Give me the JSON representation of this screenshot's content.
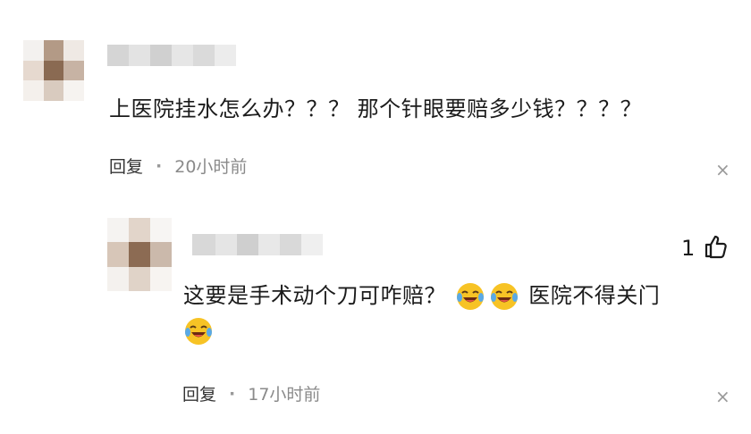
{
  "comments": [
    {
      "text": "上医院挂水怎么办？？？ 那个针眼要赔多少钱？？？？",
      "reply_label": "回复",
      "separator": "·",
      "time": "20小时前",
      "close_glyph": "×"
    },
    {
      "text_main": "这要是手术动个刀可咋赔？",
      "text_after_emojis": "医院不得关门",
      "emoji_name": "crying-laughing-emoji",
      "like_count": "1",
      "like_icon": "thumbs-up-icon",
      "reply_label": "回复",
      "separator": "·",
      "time": "17小时前",
      "close_glyph": "×"
    }
  ],
  "colors": {
    "text": "#1b1b1b",
    "meta": "#8a8a8a",
    "emoji_face": "#f7c325"
  }
}
